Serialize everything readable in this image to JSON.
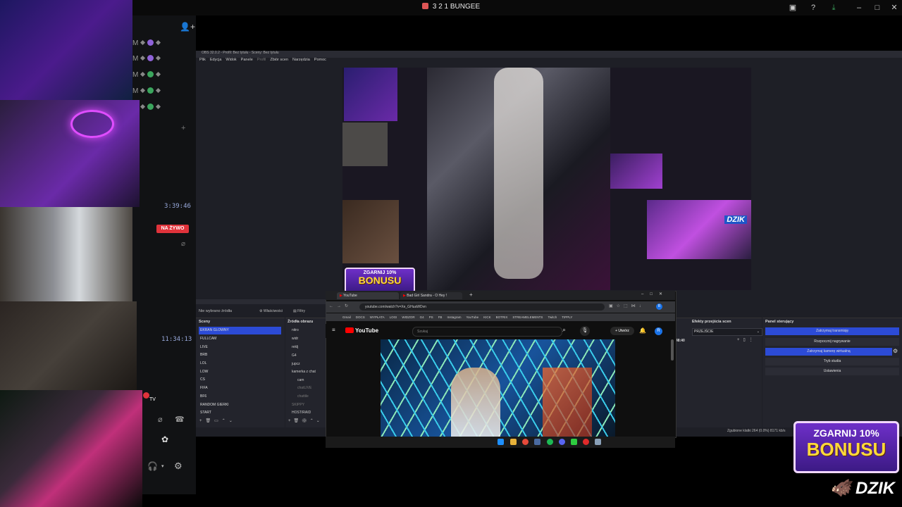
{
  "window": {
    "title": "3 2 1 BUNGEE"
  },
  "topbar_icons": [
    "inbox-icon",
    "help-icon",
    "download-icon",
    "minimize-icon",
    "maximize-icon",
    "close-icon"
  ],
  "voice_panel": {
    "add_user_icon": "add-user-icon",
    "row_letter": "M",
    "member_rows": [
      {
        "status": "purple"
      },
      {
        "status": "purple"
      },
      {
        "status": "green"
      },
      {
        "status": "green"
      },
      {
        "status": "green"
      }
    ],
    "timer_1": "3:39:46",
    "live_label": "NA ŻYWO",
    "timer_2": "11:34:13",
    "tv_label": "TV"
  },
  "obs": {
    "title": "OBS 32.0.2 - Profil: Bez tytułu - Sceny: Bez tytułu",
    "menu": [
      "Plik",
      "Edycja",
      "Widok",
      "Panele",
      "Profil",
      "Zbiór scen",
      "Narzędzia",
      "Pomoc"
    ],
    "no_source_label": "Nie wybrano źródła",
    "properties_btn": "Właściwości",
    "filters_btn": "Filtry",
    "scenes_header": "Sceny",
    "scenes": [
      "EKRAN GLOWNY",
      "FULLCAM",
      "LIVE",
      "BRB",
      "LOL",
      "LOW",
      "CS",
      "FIFA",
      "BF6",
      "RANDOM GIERKI",
      "START"
    ],
    "sources_header": "Źródła obrazu",
    "sources": [
      "nitro",
      "widr",
      "reklj",
      "G4",
      "jupcz",
      "kamerka z chat",
      "cam",
      "chatLIVE",
      "chattile",
      "SKIPPY",
      "HOST/RAID"
    ],
    "transitions_header": "Efekty przejścia scen",
    "transition_value": "PRZEJŚCIE",
    "time_value": "48:40",
    "controls_header": "Panel sterujący",
    "controls": [
      "Zatrzymaj transmisję",
      "Rozpocznij nagrywanie",
      "Zatrzymaj kamerę wirtualną",
      "Tryb studia",
      "Ustawienia"
    ],
    "status_text": "Zgubione klatki 264 (0.0%)   8171 kb/s"
  },
  "chrome": {
    "tabs": [
      "YouTube",
      "Bad Girl Sandra - O Hey !"
    ],
    "url": "youtube.com/watch?v=Xe_GHuaWDvn",
    "bookmarks": [
      "Gmail",
      "DOCS",
      "WYPŁATA",
      "LOGI",
      "WIDZOR",
      "G4",
      "PS",
      "FB",
      "Instagram",
      "YouTube",
      "KICK",
      "BOTRIX",
      "STREAMELEMENTS",
      "Twitch",
      "TIPPLY"
    ],
    "yt_logo": "YouTube",
    "yt_search_placeholder": "Szukaj",
    "create_label": "+ Utwórz",
    "avatar_letter": "R"
  },
  "ads": {
    "line1": "ZGARNIJ 10%",
    "line2": "BONUSU",
    "brand": "DZIK"
  },
  "preview_badge": "DZIK",
  "colors": {
    "live_red": "#e0333b",
    "obs_selected": "#2c4bd6",
    "online_green": "#3ba55d",
    "purple_status": "#8f63d8"
  }
}
